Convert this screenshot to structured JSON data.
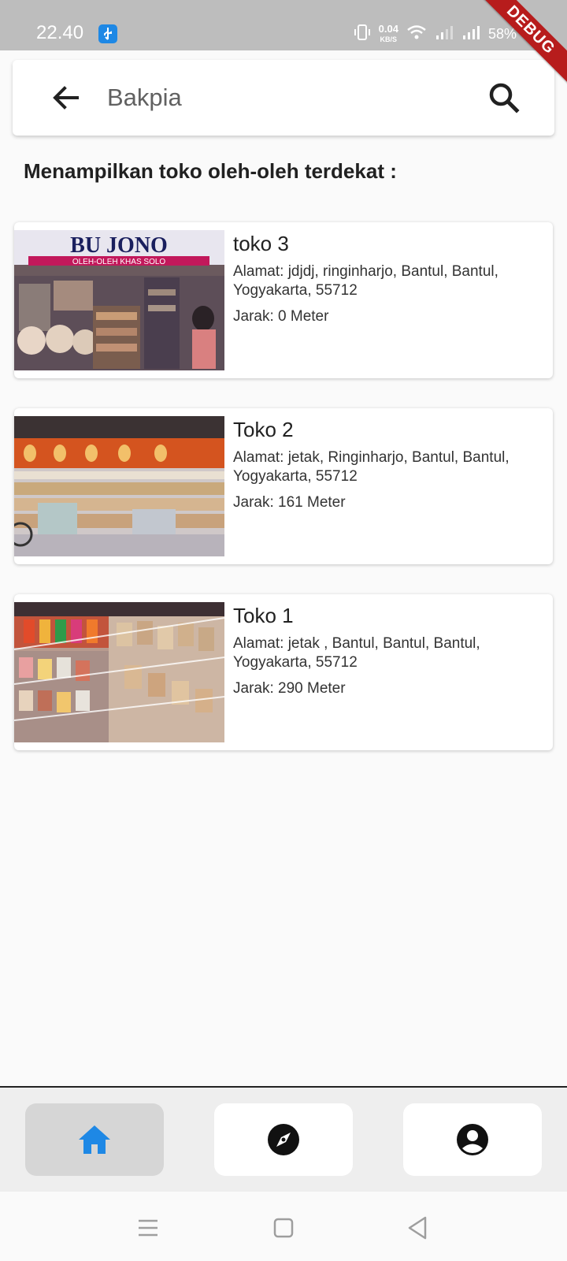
{
  "status_bar": {
    "time": "22.40",
    "net_speed_value": "0.04",
    "net_speed_unit": "KB/S",
    "battery": "58%"
  },
  "debug_banner": "DEBUG",
  "search": {
    "value": "Bakpia",
    "placeholder": "Bakpia"
  },
  "section_title": "Menampilkan toko oleh-oleh terdekat :",
  "stores": [
    {
      "name": "toko 3",
      "address": "Alamat: jdjdj, ringinharjo, Bantul, Bantul, Yogyakarta, 55712",
      "distance": "Jarak: 0 Meter",
      "image_sign": "BU JONO",
      "image_subsign": "OLEH-OLEH KHAS SOLO"
    },
    {
      "name": "Toko 2",
      "address": "Alamat: jetak, Ringinharjo, Bantul, Bantul, Yogyakarta, 55712",
      "distance": "Jarak: 161 Meter"
    },
    {
      "name": "Toko 1",
      "address": "Alamat: jetak , Bantul, Bantul, Bantul, Yogyakarta, 55712",
      "distance": "Jarak: 290 Meter"
    }
  ],
  "bottom_nav": {
    "items": [
      {
        "icon": "home-icon",
        "active": true
      },
      {
        "icon": "compass-icon",
        "active": false
      },
      {
        "icon": "account-icon",
        "active": false
      }
    ],
    "active_color": "#1e88e5",
    "inactive_color": "#111111"
  }
}
